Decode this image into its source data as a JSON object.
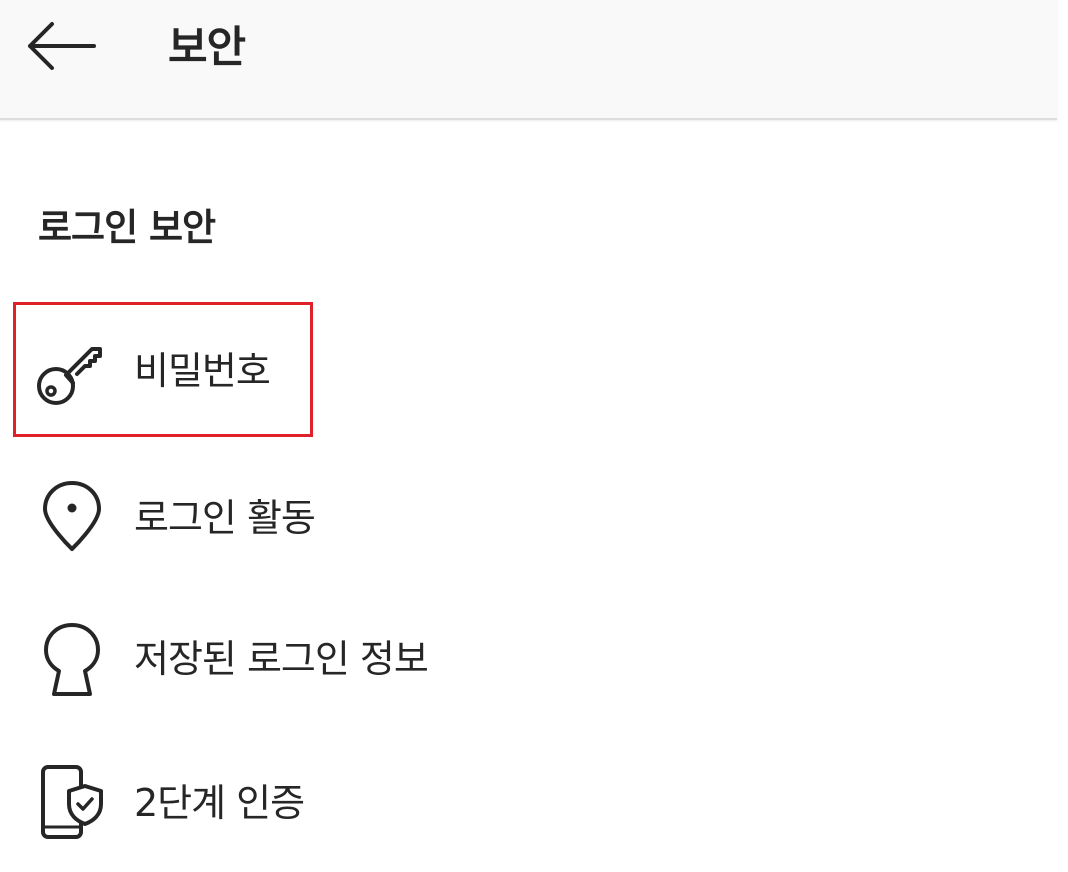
{
  "header": {
    "title": "보안",
    "back_icon": "arrow-left-icon"
  },
  "section": {
    "title": "로그인 보안"
  },
  "menu": {
    "items": [
      {
        "label": "비밀번호",
        "icon": "key-icon",
        "highlighted": true
      },
      {
        "label": "로그인 활동",
        "icon": "location-pin-icon",
        "highlighted": false
      },
      {
        "label": "저장된 로그인 정보",
        "icon": "keyhole-icon",
        "highlighted": false
      },
      {
        "label": "2단계 인증",
        "icon": "phone-shield-icon",
        "highlighted": false
      }
    ]
  },
  "colors": {
    "highlight_border": "#e0202a",
    "header_background": "#f9f9f9",
    "text": "#262626"
  }
}
